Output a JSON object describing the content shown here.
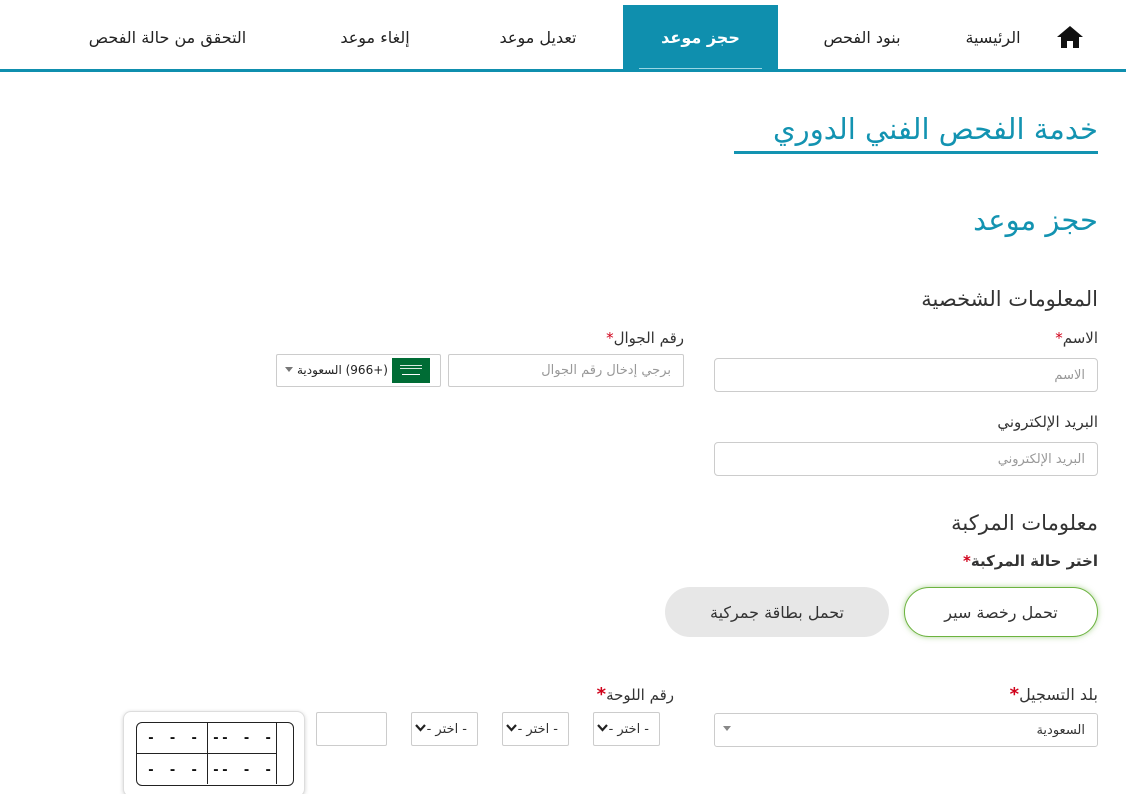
{
  "nav": {
    "home_label": "الرئيسية",
    "items": [
      {
        "label": "بنود الفحص"
      },
      {
        "label": "حجز موعد"
      },
      {
        "label": "تعديل موعد"
      },
      {
        "label": "إلغاء موعد"
      },
      {
        "label": "التحقق من حالة الفحص"
      }
    ],
    "active": "حجز موعد",
    "accent_color": "#0f8fae"
  },
  "page": {
    "service_title": "خدمة الفحص الفني الدوري",
    "booking_title": "حجز موعد"
  },
  "personal": {
    "section_title": "المعلومات الشخصية",
    "name_label": "الاسم",
    "name_placeholder": "الاسم",
    "mobile_label": "رقم الجوال",
    "mobile_placeholder": "برجي إدخال رقم الجوال",
    "country_code_value": "(+966) السعودية",
    "email_label": "البريد الإلكتروني",
    "email_placeholder": "البريد الإلكتروني",
    "required_mark": "*"
  },
  "vehicle": {
    "section_title": "معلومات المركبة",
    "status_label": "اختر حالة المركبة",
    "status_options": [
      "تحمل رخصة سير",
      "تحمل بطاقة جمركية"
    ],
    "status_selected": "تحمل رخصة سير",
    "registration_country_label": "بلد التسجيل",
    "registration_country_value": "السعودية",
    "plate_label": "رقم اللوحة",
    "plate_selects": [
      "- اختر -",
      "- اختر -",
      "- اختر -"
    ],
    "plate_preview": {
      "top_letters": "- - -",
      "top_numbers": "- - - -",
      "bottom_letters": "- - -",
      "bottom_numbers": "- - - -"
    },
    "selected_color": "#6cb33f"
  }
}
